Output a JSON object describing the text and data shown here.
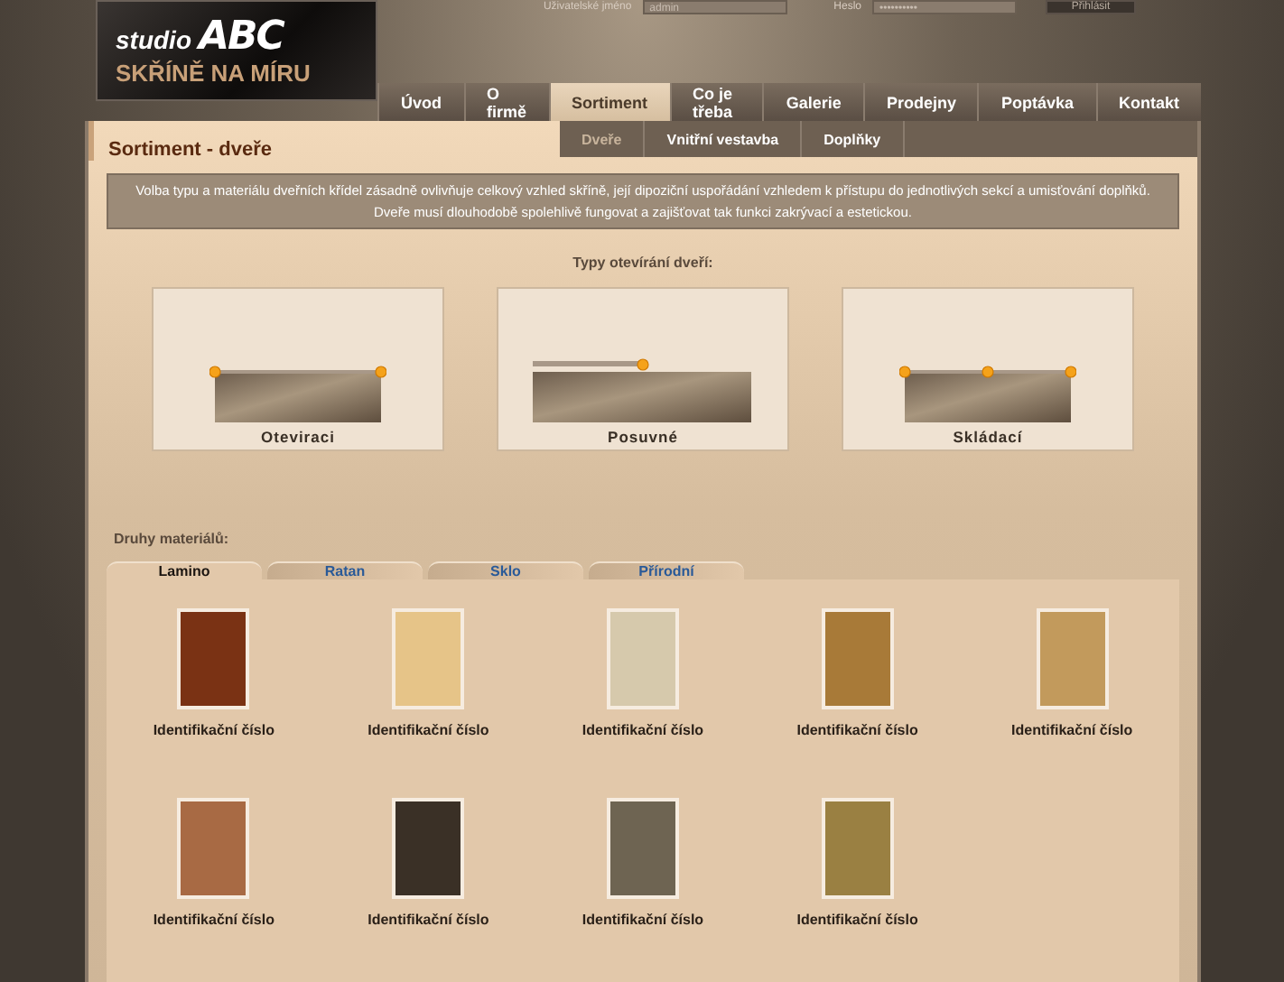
{
  "login": {
    "username_label": "Uživatelské jméno",
    "username_value": "admin",
    "password_label": "Heslo",
    "password_value": "••••••••••",
    "button": "Přihlásit"
  },
  "logo": {
    "small": "studio",
    "brand": "ABC",
    "tagline": "SKŘÍNĚ NA MÍRU"
  },
  "nav": [
    {
      "label": "Úvod",
      "selected": false
    },
    {
      "label": "O firmě",
      "selected": false
    },
    {
      "label": "Sortiment",
      "selected": true
    },
    {
      "label": "Co je třeba",
      "selected": false
    },
    {
      "label": "Galerie",
      "selected": false
    },
    {
      "label": "Prodejny",
      "selected": false
    },
    {
      "label": "Poptávka",
      "selected": false
    },
    {
      "label": "Kontakt",
      "selected": false
    }
  ],
  "page_title": "Sortiment - dveře",
  "subnav": [
    {
      "label": "Dveře",
      "selected": true
    },
    {
      "label": "Vnitřní vestavba",
      "selected": false
    },
    {
      "label": "Doplňky",
      "selected": false
    }
  ],
  "intro": [
    "Volba typu a materiálu dveřních křídel zásadně ovlivňuje celkový vzhled skříně, její dipoziční uspořádání vzhledem k přístupu do jednotlivých sekcí  a umisťování  doplňků.",
    "Dveře musí  dlouhodobě spolehlivě fungovat a zajišťovat  tak funkci zakrývací a estetickou."
  ],
  "door_types_heading": "Typy otevírání dveří:",
  "door_types": [
    {
      "kind": "hinged",
      "label": "Oteviraci"
    },
    {
      "kind": "sliding",
      "label": "Posuvné"
    },
    {
      "kind": "folding",
      "label": "Skládací"
    }
  ],
  "materials_heading": "Druhy materiálů:",
  "material_tabs": [
    {
      "label": "Lamino",
      "selected": true
    },
    {
      "label": "Ratan",
      "selected": false
    },
    {
      "label": "Sklo",
      "selected": false
    },
    {
      "label": "Přírodní",
      "selected": false
    }
  ],
  "materials": [
    {
      "label": "Identifikační číslo",
      "color": "#7a3214"
    },
    {
      "label": "Identifikační číslo",
      "color": "#e6c488"
    },
    {
      "label": "Identifikační číslo",
      "color": "#d6c9ac"
    },
    {
      "label": "Identifikační číslo",
      "color": "#a87a38"
    },
    {
      "label": "Identifikační číslo",
      "color": "#c29a5c"
    },
    {
      "label": "Identifikační číslo",
      "color": "#a86a44"
    },
    {
      "label": "Identifikační číslo",
      "color": "#3a3026"
    },
    {
      "label": "Identifikační číslo",
      "color": "#6e6452"
    },
    {
      "label": "Identifikační číslo",
      "color": "#9a8042"
    }
  ]
}
